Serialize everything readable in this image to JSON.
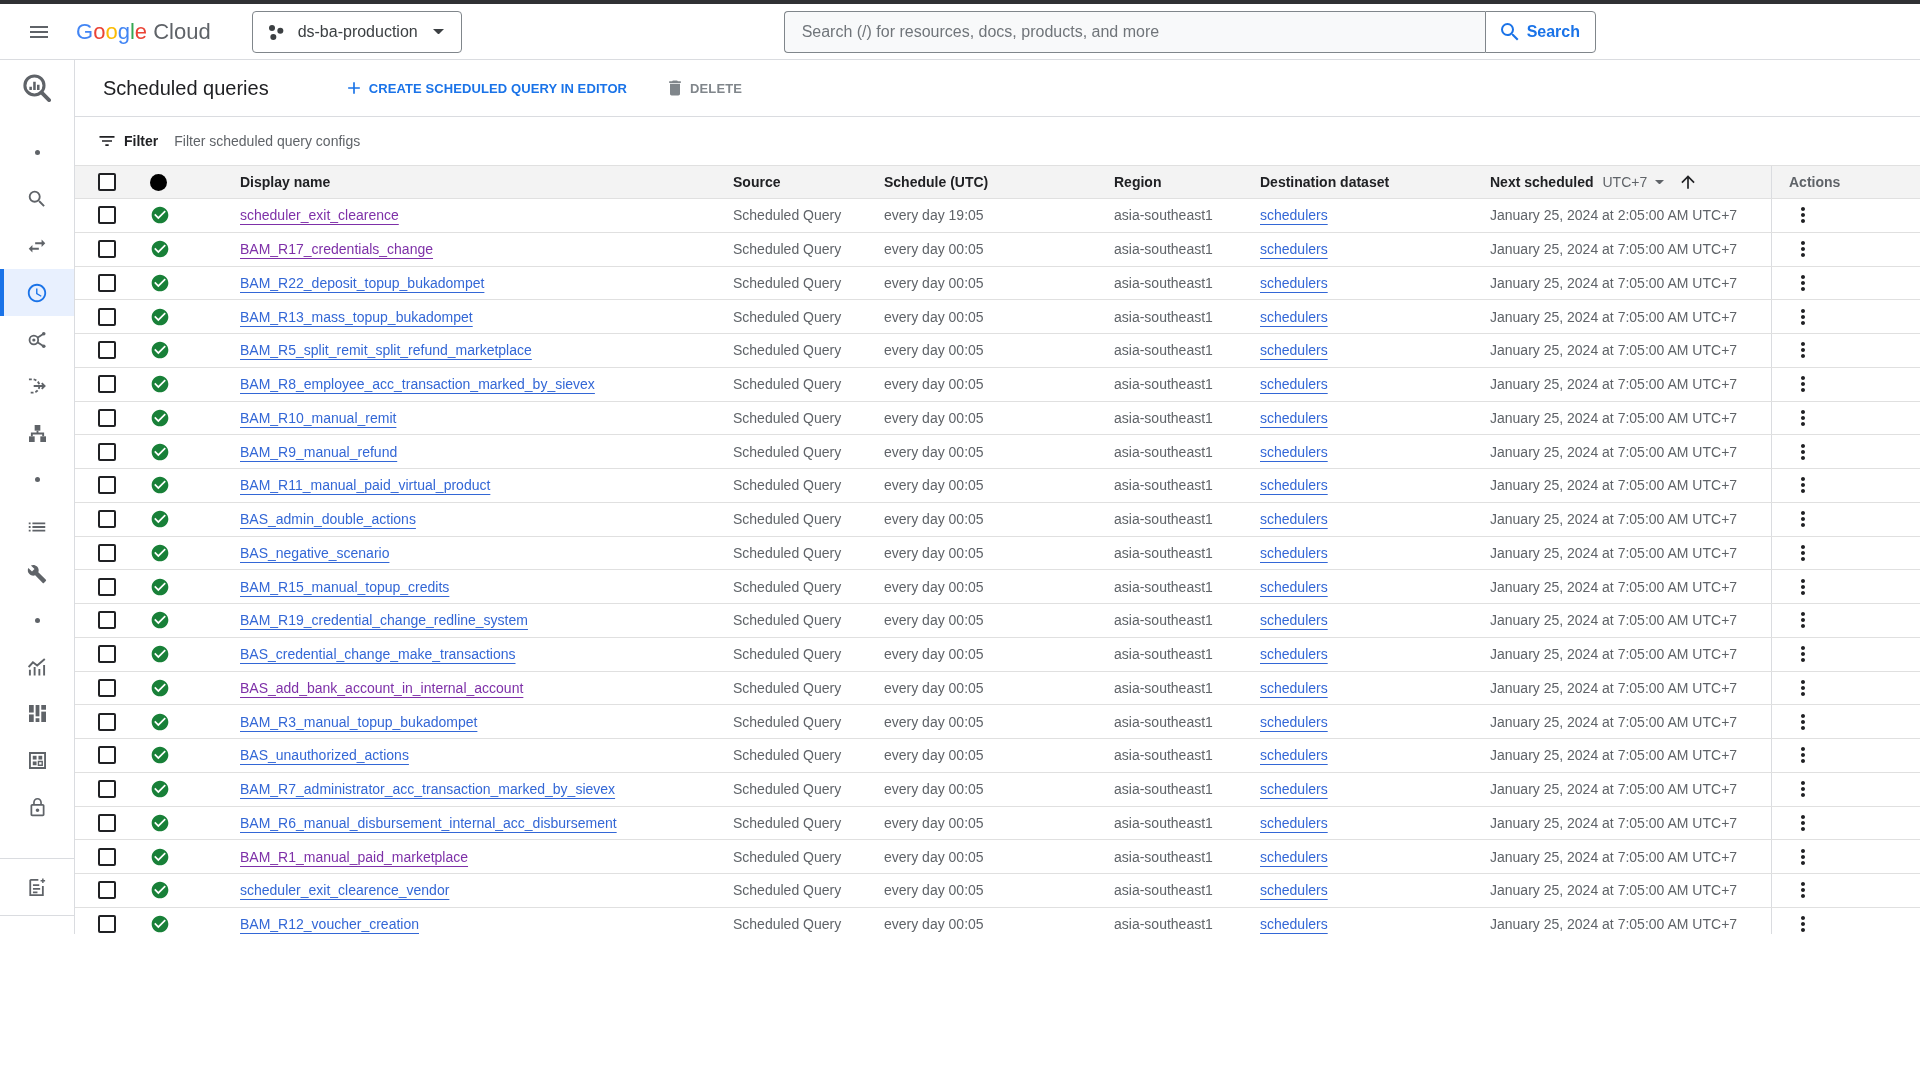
{
  "top_bar": {
    "brand": {
      "name": "Google",
      "product": "Cloud"
    },
    "project": "ds-ba-production",
    "search": {
      "placeholder": "Search (/) for resources, docs, products, and more",
      "button": "Search"
    }
  },
  "rail": {
    "items": [
      {
        "kind": "dot",
        "selected": false
      },
      {
        "kind": "search",
        "selected": false
      },
      {
        "kind": "arrows",
        "selected": false
      },
      {
        "kind": "clock",
        "selected": true
      },
      {
        "kind": "hub",
        "selected": false
      },
      {
        "kind": "pipeline",
        "selected": false
      },
      {
        "kind": "tree",
        "selected": false
      },
      {
        "kind": "dot",
        "selected": false
      },
      {
        "kind": "list",
        "selected": false
      },
      {
        "kind": "wrench",
        "selected": false
      },
      {
        "kind": "dot",
        "selected": false
      },
      {
        "kind": "chart",
        "selected": false
      },
      {
        "kind": "dashboard",
        "selected": false
      },
      {
        "kind": "table",
        "selected": false
      },
      {
        "kind": "lock",
        "selected": false
      }
    ],
    "footer_items": [
      {
        "kind": "notes",
        "selected": false
      }
    ]
  },
  "page": {
    "title": "Scheduled queries",
    "actions": [
      {
        "kind": "create",
        "label": "CREATE SCHEDULED QUERY IN EDITOR",
        "disabled": false
      },
      {
        "kind": "delete",
        "label": "DELETE",
        "disabled": true
      }
    ]
  },
  "filter": {
    "label": "Filter",
    "placeholder": "Filter scheduled query configs"
  },
  "table": {
    "select_all": {
      "checked": false
    },
    "columns": [
      {
        "label": "Display name"
      },
      {
        "label": "Source"
      },
      {
        "label": "Schedule (UTC)"
      },
      {
        "label": "Region"
      },
      {
        "label": "Destination dataset"
      },
      {
        "label": "Next scheduled",
        "timezone": "UTC+7",
        "sort_ascending": true
      },
      {
        "label": "Actions"
      }
    ],
    "rows": [
      {
        "checked": false,
        "succeeded": true,
        "name": "scheduler_exit_clearence",
        "visited": true,
        "source": "Scheduled Query",
        "schedule": "every day 19:05",
        "region": "asia-southeast1",
        "dataset": "schedulers",
        "next_run": "January 25, 2024 at 2:05:00 AM UTC+7"
      },
      {
        "checked": false,
        "succeeded": true,
        "name": "BAM_R17_credentials_change",
        "visited": true,
        "source": "Scheduled Query",
        "schedule": "every day 00:05",
        "region": "asia-southeast1",
        "dataset": "schedulers",
        "next_run": "January 25, 2024 at 7:05:00 AM UTC+7"
      },
      {
        "checked": false,
        "succeeded": true,
        "name": "BAM_R22_deposit_topup_bukadompet",
        "visited": false,
        "source": "Scheduled Query",
        "schedule": "every day 00:05",
        "region": "asia-southeast1",
        "dataset": "schedulers",
        "next_run": "January 25, 2024 at 7:05:00 AM UTC+7"
      },
      {
        "checked": false,
        "succeeded": true,
        "name": "BAM_R13_mass_topup_bukadompet",
        "visited": false,
        "source": "Scheduled Query",
        "schedule": "every day 00:05",
        "region": "asia-southeast1",
        "dataset": "schedulers",
        "next_run": "January 25, 2024 at 7:05:00 AM UTC+7"
      },
      {
        "checked": false,
        "succeeded": true,
        "name": "BAM_R5_split_remit_split_refund_marketplace",
        "visited": false,
        "source": "Scheduled Query",
        "schedule": "every day 00:05",
        "region": "asia-southeast1",
        "dataset": "schedulers",
        "next_run": "January 25, 2024 at 7:05:00 AM UTC+7"
      },
      {
        "checked": false,
        "succeeded": true,
        "name": "BAM_R8_employee_acc_transaction_marked_by_sievex",
        "visited": false,
        "source": "Scheduled Query",
        "schedule": "every day 00:05",
        "region": "asia-southeast1",
        "dataset": "schedulers",
        "next_run": "January 25, 2024 at 7:05:00 AM UTC+7"
      },
      {
        "checked": false,
        "succeeded": true,
        "name": "BAM_R10_manual_remit",
        "visited": false,
        "source": "Scheduled Query",
        "schedule": "every day 00:05",
        "region": "asia-southeast1",
        "dataset": "schedulers",
        "next_run": "January 25, 2024 at 7:05:00 AM UTC+7"
      },
      {
        "checked": false,
        "succeeded": true,
        "name": "BAM_R9_manual_refund",
        "visited": false,
        "source": "Scheduled Query",
        "schedule": "every day 00:05",
        "region": "asia-southeast1",
        "dataset": "schedulers",
        "next_run": "January 25, 2024 at 7:05:00 AM UTC+7"
      },
      {
        "checked": false,
        "succeeded": true,
        "name": "BAM_R11_manual_paid_virtual_product",
        "visited": false,
        "source": "Scheduled Query",
        "schedule": "every day 00:05",
        "region": "asia-southeast1",
        "dataset": "schedulers",
        "next_run": "January 25, 2024 at 7:05:00 AM UTC+7"
      },
      {
        "checked": false,
        "succeeded": true,
        "name": "BAS_admin_double_actions",
        "visited": false,
        "source": "Scheduled Query",
        "schedule": "every day 00:05",
        "region": "asia-southeast1",
        "dataset": "schedulers",
        "next_run": "January 25, 2024 at 7:05:00 AM UTC+7"
      },
      {
        "checked": false,
        "succeeded": true,
        "name": "BAS_negative_scenario",
        "visited": false,
        "source": "Scheduled Query",
        "schedule": "every day 00:05",
        "region": "asia-southeast1",
        "dataset": "schedulers",
        "next_run": "January 25, 2024 at 7:05:00 AM UTC+7"
      },
      {
        "checked": false,
        "succeeded": true,
        "name": "BAM_R15_manual_topup_credits",
        "visited": false,
        "source": "Scheduled Query",
        "schedule": "every day 00:05",
        "region": "asia-southeast1",
        "dataset": "schedulers",
        "next_run": "January 25, 2024 at 7:05:00 AM UTC+7"
      },
      {
        "checked": false,
        "succeeded": true,
        "name": "BAM_R19_credential_change_redline_system",
        "visited": false,
        "source": "Scheduled Query",
        "schedule": "every day 00:05",
        "region": "asia-southeast1",
        "dataset": "schedulers",
        "next_run": "January 25, 2024 at 7:05:00 AM UTC+7"
      },
      {
        "checked": false,
        "succeeded": true,
        "name": "BAS_credential_change_make_transactions",
        "visited": false,
        "source": "Scheduled Query",
        "schedule": "every day 00:05",
        "region": "asia-southeast1",
        "dataset": "schedulers",
        "next_run": "January 25, 2024 at 7:05:00 AM UTC+7"
      },
      {
        "checked": false,
        "succeeded": true,
        "name": "BAS_add_bank_account_in_internal_account",
        "visited": true,
        "source": "Scheduled Query",
        "schedule": "every day 00:05",
        "region": "asia-southeast1",
        "dataset": "schedulers",
        "next_run": "January 25, 2024 at 7:05:00 AM UTC+7"
      },
      {
        "checked": false,
        "succeeded": true,
        "name": "BAM_R3_manual_topup_bukadompet",
        "visited": false,
        "source": "Scheduled Query",
        "schedule": "every day 00:05",
        "region": "asia-southeast1",
        "dataset": "schedulers",
        "next_run": "January 25, 2024 at 7:05:00 AM UTC+7"
      },
      {
        "checked": false,
        "succeeded": true,
        "name": "BAS_unauthorized_actions",
        "visited": false,
        "source": "Scheduled Query",
        "schedule": "every day 00:05",
        "region": "asia-southeast1",
        "dataset": "schedulers",
        "next_run": "January 25, 2024 at 7:05:00 AM UTC+7"
      },
      {
        "checked": false,
        "succeeded": true,
        "name": "BAM_R7_administrator_acc_transaction_marked_by_sievex",
        "visited": false,
        "source": "Scheduled Query",
        "schedule": "every day 00:05",
        "region": "asia-southeast1",
        "dataset": "schedulers",
        "next_run": "January 25, 2024 at 7:05:00 AM UTC+7"
      },
      {
        "checked": false,
        "succeeded": true,
        "name": "BAM_R6_manual_disbursement_internal_acc_disbursement",
        "visited": false,
        "source": "Scheduled Query",
        "schedule": "every day 00:05",
        "region": "asia-southeast1",
        "dataset": "schedulers",
        "next_run": "January 25, 2024 at 7:05:00 AM UTC+7"
      },
      {
        "checked": false,
        "succeeded": true,
        "name": "BAM_R1_manual_paid_marketplace",
        "visited": true,
        "source": "Scheduled Query",
        "schedule": "every day 00:05",
        "region": "asia-southeast1",
        "dataset": "schedulers",
        "next_run": "January 25, 2024 at 7:05:00 AM UTC+7"
      },
      {
        "checked": false,
        "succeeded": true,
        "name": "scheduler_exit_clearence_vendor",
        "visited": false,
        "source": "Scheduled Query",
        "schedule": "every day 00:05",
        "region": "asia-southeast1",
        "dataset": "schedulers",
        "next_run": "January 25, 2024 at 7:05:00 AM UTC+7"
      },
      {
        "checked": false,
        "succeeded": true,
        "name": "BAM_R12_voucher_creation",
        "visited": false,
        "source": "Scheduled Query",
        "schedule": "every day 00:05",
        "region": "asia-southeast1",
        "dataset": "schedulers",
        "next_run": "January 25, 2024 at 7:05:00 AM UTC+7"
      }
    ]
  }
}
